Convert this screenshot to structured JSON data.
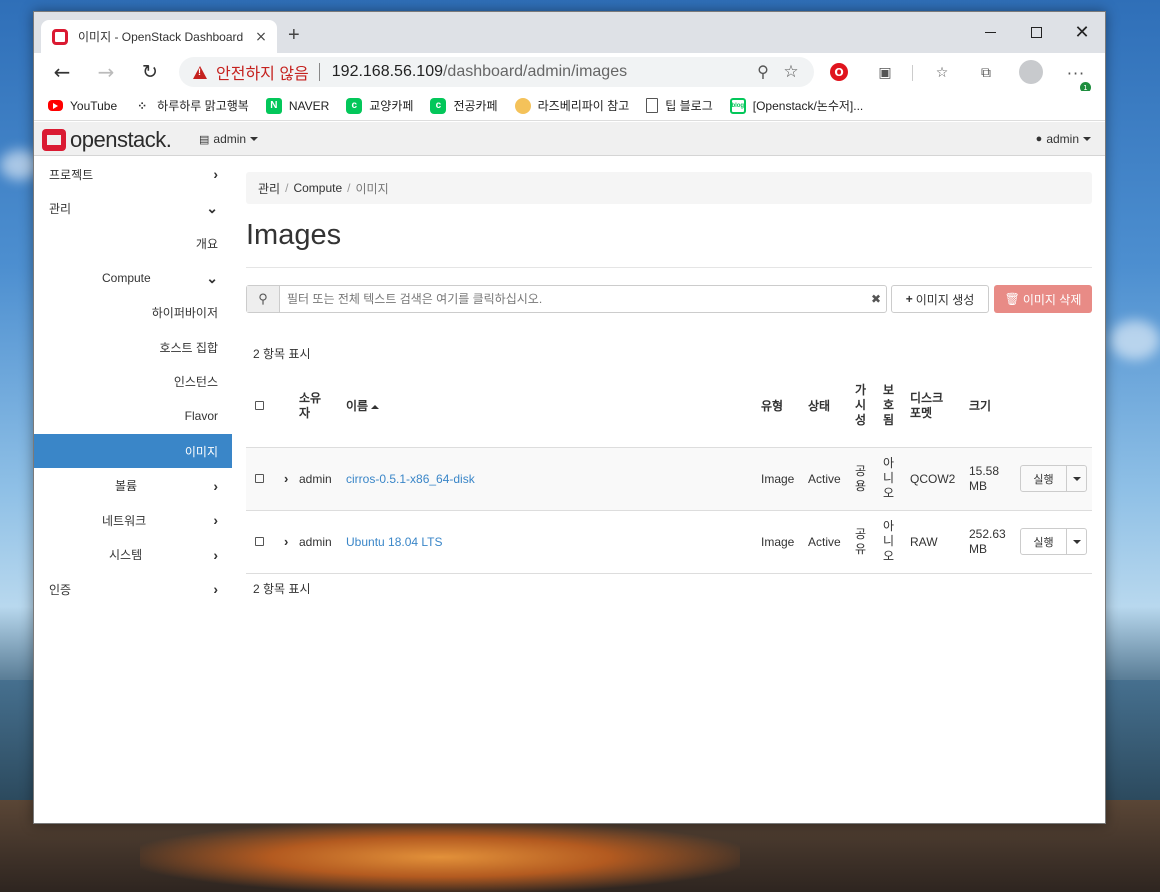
{
  "browser": {
    "tab_title": "이미지 - OpenStack Dashboard",
    "tab_close": "×",
    "new_tab": "+",
    "security_label": "안전하지 않음",
    "url_host": "192.168.56.109",
    "url_path": "/dashboard/admin/images",
    "update_badge": "1",
    "opera_badge": "O"
  },
  "bookmarks": [
    {
      "label": "YouTube",
      "icon": "youtube-icon"
    },
    {
      "label": "하루하루 맑고행복",
      "icon": "dots-icon"
    },
    {
      "label": "NAVER",
      "icon": "naver-icon"
    },
    {
      "label": "교양카페",
      "icon": "cafe-icon"
    },
    {
      "label": "전공카페",
      "icon": "cafe-icon"
    },
    {
      "label": "라즈베리파이 참고",
      "icon": "avatar-icon"
    },
    {
      "label": "팁 블로그",
      "icon": "document-icon"
    },
    {
      "label": "[Openstack/논수저]...",
      "icon": "blog-icon"
    }
  ],
  "header": {
    "logo_text": "openstack.",
    "project": "admin",
    "user": "admin"
  },
  "sidebar": {
    "items": [
      {
        "label": "프로젝트",
        "chevron": "›"
      },
      {
        "label": "관리",
        "chevron": "⌄"
      },
      {
        "label": "개요",
        "chevron": ""
      },
      {
        "label": "Compute",
        "chevron": "⌄"
      },
      {
        "label": "하이퍼바이저",
        "chevron": ""
      },
      {
        "label": "호스트 집합",
        "chevron": ""
      },
      {
        "label": "인스턴스",
        "chevron": ""
      },
      {
        "label": "Flavor",
        "chevron": ""
      },
      {
        "label": "이미지",
        "chevron": "",
        "active": true
      },
      {
        "label": "볼륨",
        "chevron": "›"
      },
      {
        "label": "네트워크",
        "chevron": "›"
      },
      {
        "label": "시스템",
        "chevron": "›"
      },
      {
        "label": "인증",
        "chevron": "›"
      }
    ]
  },
  "breadcrumb": {
    "items": [
      "관리",
      "Compute",
      "이미지"
    ],
    "sep": "/"
  },
  "page": {
    "title": "Images",
    "search_placeholder": "필터 또는 전체 텍스트 검색은 여기를 클릭하십시오.",
    "create_label": "이미지 생성",
    "delete_label": "이미지 삭제",
    "count_text": "2 항목 표시"
  },
  "table": {
    "headers": {
      "owner": "소유\n자",
      "name": "이름",
      "type": "유형",
      "status": "상태",
      "visibility": "가\n시\n성",
      "protected": "보\n호\n됨",
      "disk_format": "디스크\n포멧",
      "size": "크기"
    },
    "rows": [
      {
        "owner": "admin",
        "name": "cirros-0.5.1-x86_64-disk",
        "type": "Image",
        "status": "Active",
        "visibility": "공\n용",
        "protected": "아\n니\n오",
        "disk_format": "QCOW2",
        "size": "15.58\nMB",
        "action": "실행"
      },
      {
        "owner": "admin",
        "name": "Ubuntu 18.04 LTS",
        "type": "Image",
        "status": "Active",
        "visibility": "공\n유",
        "protected": "아\n니\n오",
        "disk_format": "RAW",
        "size": "252.63\nMB",
        "action": "실행"
      }
    ]
  }
}
